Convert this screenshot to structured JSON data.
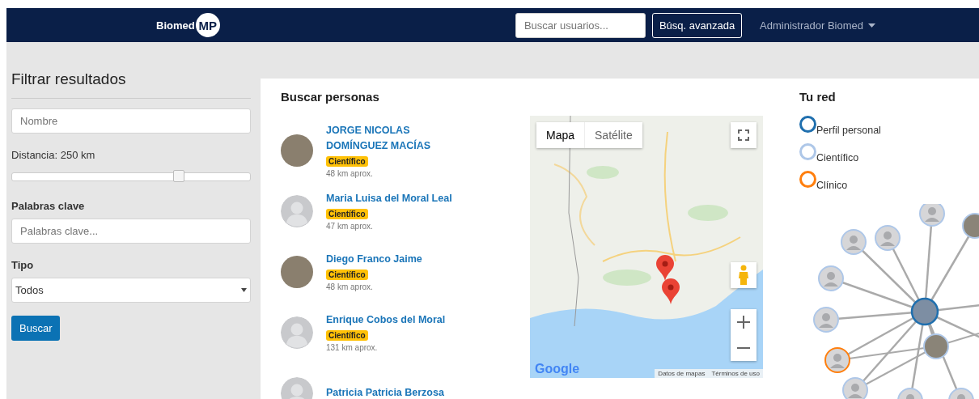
{
  "navbar": {
    "brand": "Biomed",
    "brand_badge": "MP",
    "search": {
      "placeholder": "Buscar usuarios..."
    },
    "advanced_button": "Búsq. avanzada",
    "user_menu": "Administrador Biomed"
  },
  "filters": {
    "title": "Filtrar resultados",
    "name_field": {
      "placeholder": "Nombre"
    },
    "distance_label": "Distancia: 250 km",
    "distance_slider": {
      "level": 0.7
    },
    "keywords_label": "Palabras clave",
    "keywords_field": {
      "placeholder": "Palabras clave..."
    },
    "type_label": "Tipo",
    "type_select": {
      "value": "Todos"
    },
    "search_button": "Buscar"
  },
  "people": {
    "title": "Buscar personas",
    "items": [
      {
        "name": "JORGE NICOLAS DOMÍNGUEZ MACÍAS",
        "kind": "photo",
        "badge": "Científico",
        "distance": "48 km aprox."
      },
      {
        "name": "Maria Luisa del Moral Leal",
        "kind": "default",
        "badge": "Científico",
        "distance": "47 km aprox."
      },
      {
        "name": "Diego Franco Jaime",
        "kind": "photo",
        "badge": "Científico",
        "distance": "48 km aprox."
      },
      {
        "name": "Enrique Cobos del Moral",
        "kind": "default",
        "badge": "Científico",
        "distance": "131 km aprox."
      },
      {
        "name": "Patricia Patricia Berzosa",
        "kind": "default"
      }
    ]
  },
  "map": {
    "tabs": [
      {
        "label": "Mapa",
        "selected": true
      },
      {
        "label": "Satélite",
        "selected": false
      }
    ],
    "logo": "Google",
    "footer_links": [
      "Datos de mapas",
      "Términos de uso"
    ]
  },
  "network": {
    "title": "Tu red",
    "legend": [
      {
        "label": "Perfil personal",
        "color": "#1f6fae"
      },
      {
        "label": "Científico",
        "color": "#aec7e8"
      },
      {
        "label": "Clínico",
        "color": "#ff7f0e"
      }
    ]
  }
}
